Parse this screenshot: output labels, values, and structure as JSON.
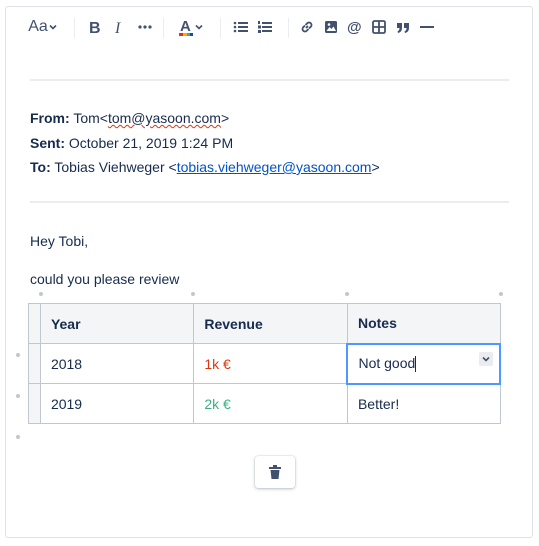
{
  "toolbar": {
    "text_style_label": "Aa",
    "buttons": [
      "bold",
      "italic",
      "more-formatting",
      "text-color",
      "bullet-list",
      "numbered-list",
      "link",
      "image",
      "mention",
      "table",
      "quote",
      "divider"
    ]
  },
  "email": {
    "from_label": "From:",
    "from_name": "Tom<",
    "from_email": "tom@yasoon.com",
    "from_close": ">",
    "sent_label": "Sent:",
    "sent_value": "October 21, 2019 1:24 PM",
    "to_label": "To:",
    "to_name": "Tobias Viehweger <",
    "to_email": "tobias.viehweger@yasoon.com",
    "to_close": ">"
  },
  "body": {
    "greeting": "Hey Tobi,",
    "line1": "could you please review"
  },
  "table": {
    "headers": [
      "Year",
      "Revenue",
      "Notes"
    ],
    "rows": [
      {
        "year": "2018",
        "revenue": "1k €",
        "notes": "Not good"
      },
      {
        "year": "2019",
        "revenue": "2k €",
        "notes": "Better!"
      }
    ]
  },
  "colors": {
    "accent": "#0052cc",
    "negative": "#de350b",
    "positive": "#36b37e"
  }
}
